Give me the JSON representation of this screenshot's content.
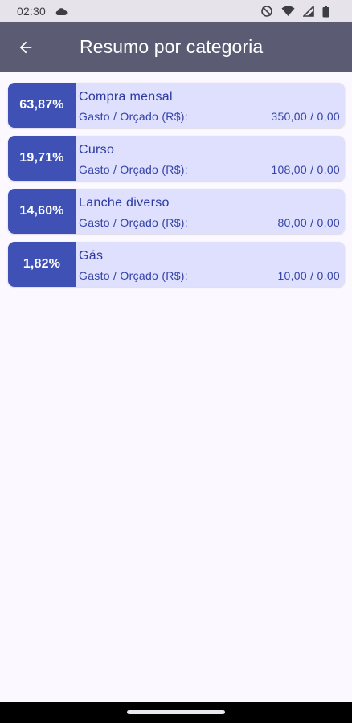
{
  "status_bar": {
    "time": "02:30",
    "icons": [
      "cloud-icon",
      "do-not-disturb-icon",
      "wifi-icon",
      "signal-icon",
      "battery-icon"
    ]
  },
  "app_bar": {
    "title": "Resumo por categoria",
    "back_icon": "arrow-left-icon",
    "background_color": "#5b5b73"
  },
  "summary": {
    "accent_color": "#3f51b5",
    "card_color": "#dfe0fd",
    "items": [
      {
        "percent": "63,87%",
        "name": "Compra mensal",
        "label": "Gasto / Orçado (R$):",
        "value": "350,00 / 0,00"
      },
      {
        "percent": "19,71%",
        "name": "Curso",
        "label": "Gasto / Orçado (R$):",
        "value": "108,00 / 0,00"
      },
      {
        "percent": "14,60%",
        "name": "Lanche diverso",
        "label": "Gasto / Orçado (R$):",
        "value": "80,00 / 0,00"
      },
      {
        "percent": "1,82%",
        "name": "Gás",
        "label": "Gasto / Orçado (R$):",
        "value": "10,00 / 0,00"
      }
    ]
  }
}
